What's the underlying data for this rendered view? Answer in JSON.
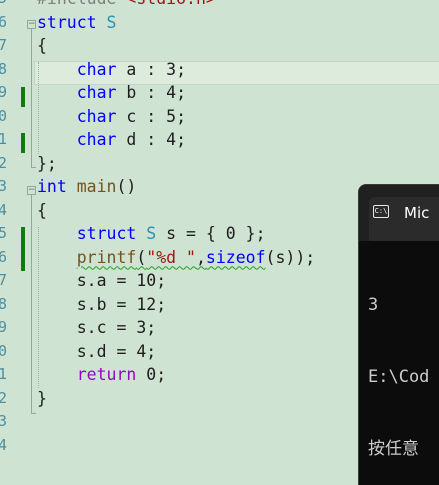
{
  "editor": {
    "line_numbers": [
      "5",
      "6",
      "7",
      "8",
      "9",
      "0",
      "1",
      "2",
      "3",
      "4",
      "5",
      "6",
      "7",
      "8",
      "9",
      "0",
      "1",
      "2",
      "3",
      "4"
    ],
    "lines": [
      {
        "tokens": [
          {
            "t": "#include ",
            "c": "pre"
          },
          {
            "t": "<stdio.h>",
            "c": "str"
          }
        ]
      },
      {
        "tokens": [
          {
            "t": "struct ",
            "c": "kw"
          },
          {
            "t": "S",
            "c": "ty"
          }
        ]
      },
      {
        "tokens": [
          {
            "t": "{",
            "c": ""
          }
        ]
      },
      {
        "tokens": [
          {
            "t": "    ",
            "c": ""
          },
          {
            "t": "char",
            "c": "kw"
          },
          {
            "t": " a : 3;",
            "c": ""
          }
        ]
      },
      {
        "tokens": [
          {
            "t": "    ",
            "c": ""
          },
          {
            "t": "char",
            "c": "kw"
          },
          {
            "t": " b : 4;",
            "c": ""
          }
        ]
      },
      {
        "tokens": [
          {
            "t": "    ",
            "c": ""
          },
          {
            "t": "char",
            "c": "kw"
          },
          {
            "t": " c : 5;",
            "c": ""
          }
        ]
      },
      {
        "tokens": [
          {
            "t": "    ",
            "c": ""
          },
          {
            "t": "char",
            "c": "kw"
          },
          {
            "t": " d : 4;",
            "c": ""
          }
        ]
      },
      {
        "tokens": [
          {
            "t": "};",
            "c": ""
          }
        ]
      },
      {
        "tokens": [
          {
            "t": "int",
            "c": "kw"
          },
          {
            "t": " ",
            "c": ""
          },
          {
            "t": "main",
            "c": "fn"
          },
          {
            "t": "()",
            "c": ""
          }
        ]
      },
      {
        "tokens": [
          {
            "t": "{",
            "c": ""
          }
        ]
      },
      {
        "tokens": [
          {
            "t": "    ",
            "c": ""
          },
          {
            "t": "struct",
            "c": "kw"
          },
          {
            "t": " ",
            "c": ""
          },
          {
            "t": "S",
            "c": "ty"
          },
          {
            "t": " s = { 0 };",
            "c": ""
          }
        ]
      },
      {
        "tokens": [
          {
            "t": "    ",
            "c": ""
          },
          {
            "t": "printf",
            "c": "fn sq"
          },
          {
            "t": "(",
            "c": "sq"
          },
          {
            "t": "\"%d \"",
            "c": "str sq"
          },
          {
            "t": ",",
            "c": "sq"
          },
          {
            "t": "sizeof",
            "c": "kw sq"
          },
          {
            "t": "(s));",
            "c": ""
          }
        ]
      },
      {
        "tokens": [
          {
            "t": "    s.a = 10;",
            "c": ""
          }
        ]
      },
      {
        "tokens": [
          {
            "t": "    s.b = 12;",
            "c": ""
          }
        ]
      },
      {
        "tokens": [
          {
            "t": "    s.c = 3;",
            "c": ""
          }
        ]
      },
      {
        "tokens": [
          {
            "t": "    s.d = 4;",
            "c": ""
          }
        ]
      },
      {
        "tokens": [
          {
            "t": "    ",
            "c": ""
          },
          {
            "t": "return",
            "c": "ctrl"
          },
          {
            "t": " 0;",
            "c": ""
          }
        ]
      },
      {
        "tokens": [
          {
            "t": "}",
            "c": ""
          }
        ]
      },
      {
        "tokens": []
      },
      {
        "tokens": []
      }
    ]
  },
  "console": {
    "title": "Mic",
    "icon": "cmd-icon",
    "icon_text": "C:\\",
    "output": [
      "3",
      "E:\\Cod",
      "按任意"
    ]
  }
}
